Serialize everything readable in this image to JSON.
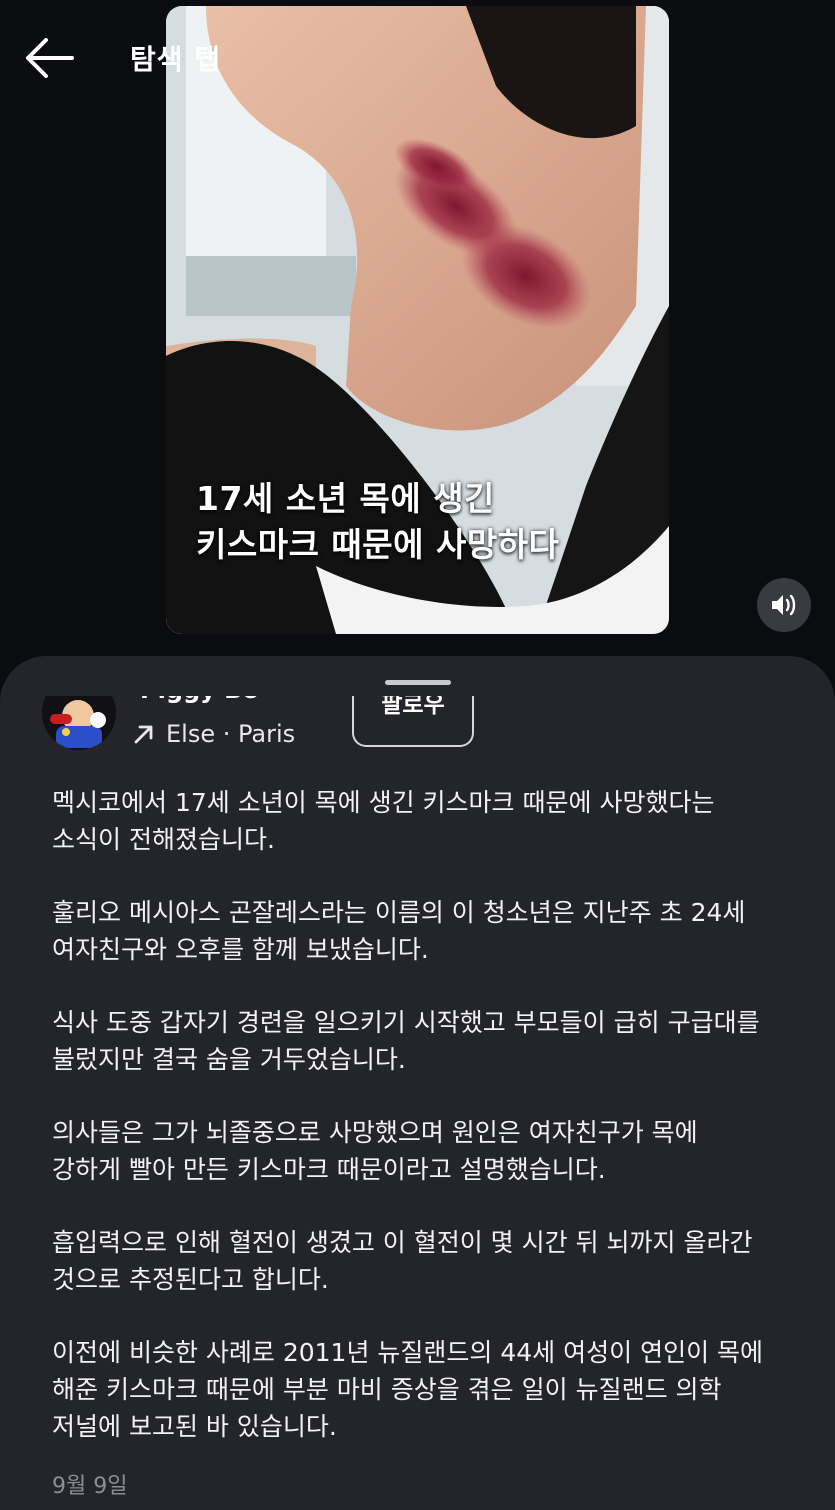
{
  "header": {
    "title": "탐색 탭"
  },
  "media": {
    "caption_line1": "17세 소년 목에 생긴",
    "caption_line2": "키스마크 때문에 사망하다"
  },
  "post": {
    "author_name": "Piggy Boy",
    "location": "Else · Paris",
    "follow_label": "팔로우",
    "paragraphs": [
      "멕시코에서 17세 소년이 목에 생긴 키스마크 때문에 사망했다는\n소식이 전해졌습니다.",
      "훌리오 메시아스 곤잘레스라는 이름의 이 청소년은 지난주 초 24세\n여자친구와 오후를 함께 보냈습니다.",
      "식사 도중 갑자기 경련을 일으키기 시작했고 부모들이 급히 구급대를\n불렀지만 결국 숨을 거두었습니다.",
      "의사들은 그가 뇌졸중으로 사망했으며 원인은 여자친구가 목에\n강하게 빨아 만든 키스마크 때문이라고 설명했습니다.",
      "흡입력으로 인해 혈전이 생겼고 이 혈전이 몇 시간 뒤 뇌까지 올라간\n것으로 추정된다고 합니다.",
      "이전에 비슷한 사례로 2011년 뉴질랜드의 44세 여성이 연인이 목에\n해준 키스마크 때문에 부분 마비 증상을 겪은 일이 뉴질랜드 의학\n저널에 보고된 바 있습니다."
    ],
    "date": "9월 9일"
  },
  "icons": {
    "back": "arrow-left-icon",
    "sound": "speaker-icon",
    "location": "arrow-up-right-icon"
  },
  "colors": {
    "background": "#0b0c10",
    "sheet": "#24252a",
    "text": "#f2f2f4",
    "muted": "#8d8e93"
  }
}
